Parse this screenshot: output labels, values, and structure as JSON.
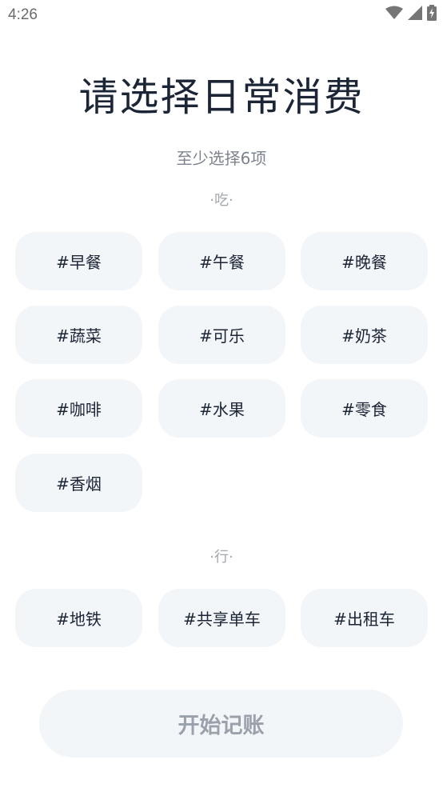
{
  "status_bar": {
    "time": "4:26",
    "icons": [
      "wifi-icon",
      "signal-icon",
      "battery-charging-icon"
    ]
  },
  "header": {
    "title": "请选择日常消费",
    "subtitle": "至少选择6项"
  },
  "sections": {
    "eat": {
      "label": "·吃·",
      "tags": [
        "#早餐",
        "#午餐",
        "#晚餐",
        "#蔬菜",
        "#可乐",
        "#奶茶",
        "#咖啡",
        "#水果",
        "#零食",
        "#香烟"
      ]
    },
    "travel": {
      "label": "·行·",
      "tags": [
        "#地铁",
        "#共享单车",
        "#出租车"
      ]
    }
  },
  "actions": {
    "start_label": "开始记账"
  },
  "colors": {
    "tag_bg": "#f3f6f9",
    "text_dark": "#1b2536",
    "text_muted": "#7d838d",
    "button_disabled_text": "#9aa1ab"
  }
}
